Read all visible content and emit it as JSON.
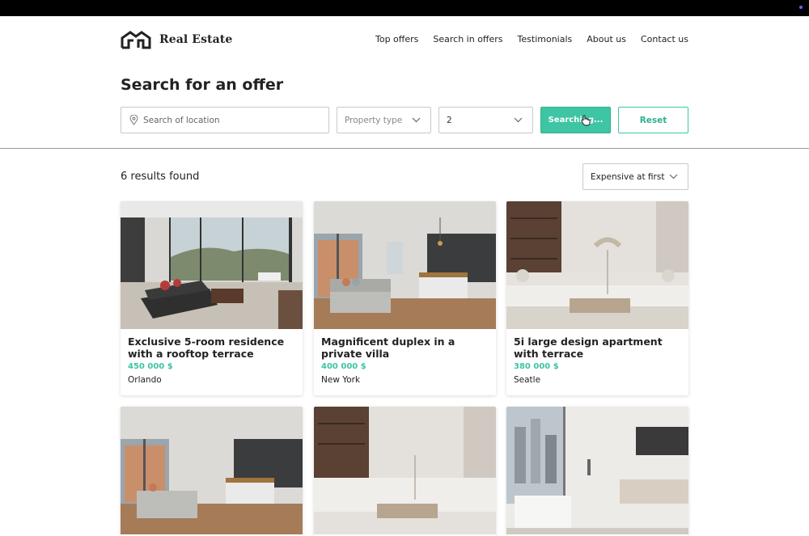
{
  "brand": {
    "name": "Real Estate",
    "icon": "house-outline-icon"
  },
  "nav": [
    "Top offers",
    "Search in offers",
    "Testimonials",
    "About us",
    "Contact us"
  ],
  "page_title": "Search for an offer",
  "search": {
    "location_placeholder": "Search of location",
    "property_type_placeholder": "Property type",
    "rooms_value": "2",
    "search_button": "Searching...",
    "reset_button": "Reset"
  },
  "results": {
    "count_text": "6 results found",
    "sort_value": "Expensive at first"
  },
  "colors": {
    "accent": "#3ec5a3",
    "topbar": "#000000"
  },
  "listings": [
    {
      "title": "Exclusive 5-room residence with a rooftop terrace",
      "price": "450 000 $",
      "city": "Orlando",
      "image": "living-room-photo"
    },
    {
      "title": "Magnificent duplex in a private villa",
      "price": "400 000 $",
      "city": "New York",
      "image": "kitchen-living-photo"
    },
    {
      "title": "5i large design apartment with terrace",
      "price": "380 000 $",
      "city": "Seatle",
      "image": "white-sofa-living-photo"
    },
    {
      "image": "kitchen-living-photo"
    },
    {
      "image": "white-sofa-living-photo"
    },
    {
      "image": "bathroom-photo"
    }
  ]
}
